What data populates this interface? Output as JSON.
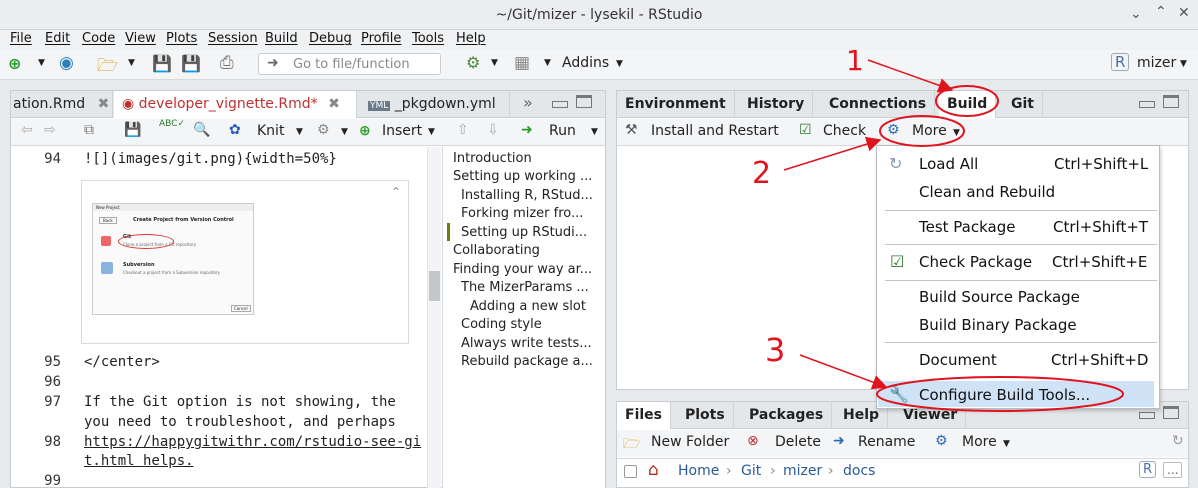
{
  "window": {
    "title": "~/Git/mizer - lysekil - RStudio"
  },
  "menubar": [
    "File",
    "Edit",
    "Code",
    "View",
    "Plots",
    "Session",
    "Build",
    "Debug",
    "Profile",
    "Tools",
    "Help"
  ],
  "toolbar": {
    "goto_placeholder": "Go to file/function",
    "addins": "Addins",
    "project": "mizer"
  },
  "editor": {
    "tabs": [
      "ation.Rmd",
      "developer_vignette.Rmd*",
      "_pkgdown.yml"
    ],
    "knit": "Knit",
    "insert": "Insert",
    "run": "Run",
    "lines": [
      {
        "n": "94",
        "text": "![](images/git.png){width=50%}"
      },
      {
        "n": "95",
        "text": "</center>"
      },
      {
        "n": "96",
        "text": ""
      },
      {
        "n": "97",
        "text": "If the Git option is not showing, the"
      },
      {
        "n": "",
        "text": "you need to troubleshoot, and perhaps"
      },
      {
        "n": "98",
        "text": "https://happygitwithr.com/rstudio-see-gi"
      },
      {
        "n": "",
        "text": "t.html helps."
      },
      {
        "n": "99",
        "text": ""
      }
    ],
    "thumb": {
      "header": "New Project",
      "back": "Back",
      "title": "Create Project from Version Control",
      "git": "Git",
      "git_sub": "Clone a project from a Git repository",
      "svn": "Subversion",
      "svn_sub": "Checkout a project from a Subversion repository",
      "cancel": "Cancel"
    }
  },
  "outline": [
    "Introduction",
    "Setting up working ...",
    "Installing R, RStud...",
    "Forking mizer fro...",
    "Setting up RStudi...",
    "Collaborating",
    "Finding your way ar...",
    "The MizerParams ...",
    "Adding a new slot",
    "Coding style",
    "Always write tests...",
    "Rebuild package a..."
  ],
  "top_right": {
    "tabs": [
      "Environment",
      "History",
      "Connections",
      "Build",
      "Git"
    ],
    "install": "Install and Restart",
    "check": "Check",
    "more": "More"
  },
  "build_menu": [
    {
      "label": "Load All",
      "shortcut": "Ctrl+Shift+L"
    },
    {
      "label": "Clean and Rebuild",
      "shortcut": ""
    },
    {
      "label": "Test Package",
      "shortcut": "Ctrl+Shift+T"
    },
    {
      "label": "Check Package",
      "shortcut": "Ctrl+Shift+E"
    },
    {
      "label": "Build Source Package",
      "shortcut": ""
    },
    {
      "label": "Build Binary Package",
      "shortcut": ""
    },
    {
      "label": "Document",
      "shortcut": "Ctrl+Shift+D"
    },
    {
      "label": "Configure Build Tools...",
      "shortcut": ""
    }
  ],
  "bottom_right": {
    "tabs": [
      "Files",
      "Plots",
      "Packages",
      "Help",
      "Viewer"
    ],
    "new_folder": "New Folder",
    "delete": "Delete",
    "rename": "Rename",
    "more": "More",
    "breadcrumb": [
      "Home",
      "Git",
      "mizer",
      "docs"
    ]
  },
  "annotations": {
    "one": "1",
    "two": "2",
    "three": "3",
    "color": "#e0141e"
  }
}
